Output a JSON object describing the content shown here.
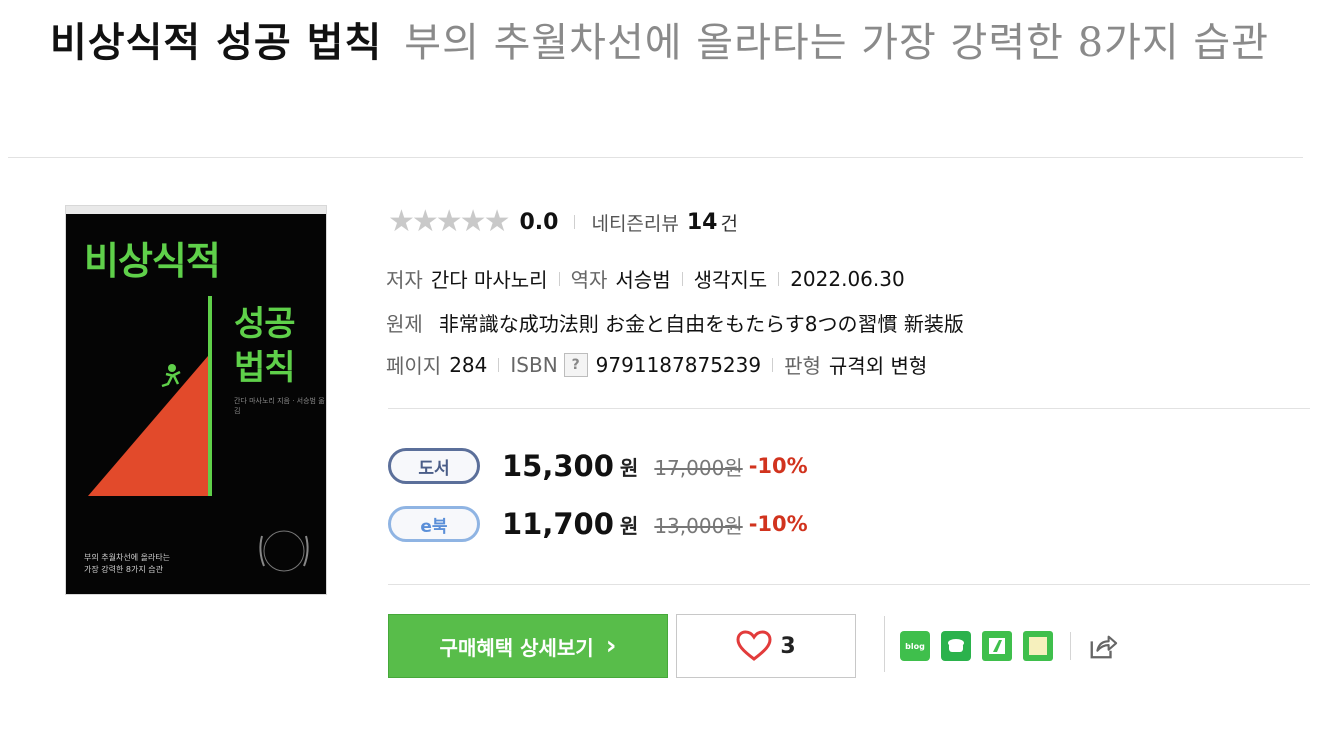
{
  "title": {
    "main": "비상식적 성공 법칙",
    "sub": "부의 추월차선에 올라타는 가장 강력한 8가지 습관"
  },
  "cover": {
    "title_line1": "비상식적",
    "title_line2": "성공",
    "title_line3": "법칙",
    "author": "간다 마사노리 지음 · 서승범 옮김",
    "tagline1": "부의 추월차선에 올라타는",
    "tagline2": "가장 강력한 8가지 습관",
    "accent_color": "#5fd04a",
    "triangle_color": "#e24a2b"
  },
  "rating": {
    "stars": "★★★★★",
    "score": "0.0",
    "review_label": "네티즌리뷰",
    "review_count": "14",
    "review_unit": "건"
  },
  "info": {
    "author_label": "저자",
    "author": "간다 마사노리",
    "translator_label": "역자",
    "translator": "서승범",
    "publisher": "생각지도",
    "date": "2022.06.30",
    "original_label": "원제",
    "original_title": "非常識な成功法則 お金と自由をもたらす8つの習慣 新装版",
    "pages_label": "페이지",
    "pages": "284",
    "isbn_label": "ISBN",
    "isbn_help": "?",
    "isbn": "9791187875239",
    "format_label": "판형",
    "format": "규격외 변형"
  },
  "prices": [
    {
      "type": "도서",
      "price": "15,300",
      "won": "원",
      "original": "17,000원",
      "discount": "-10%"
    },
    {
      "type": "e북",
      "price": "11,700",
      "won": "원",
      "original": "13,000원",
      "discount": "-10%"
    }
  ],
  "actions": {
    "buy_detail": "구매혜택 상세보기",
    "buy_chevron": "›",
    "like_count": "3",
    "blog_label": "blog"
  },
  "colors": {
    "buy_green": "#58bd4a",
    "discount_red": "#d1331e",
    "heart_red": "#e23b3b"
  }
}
